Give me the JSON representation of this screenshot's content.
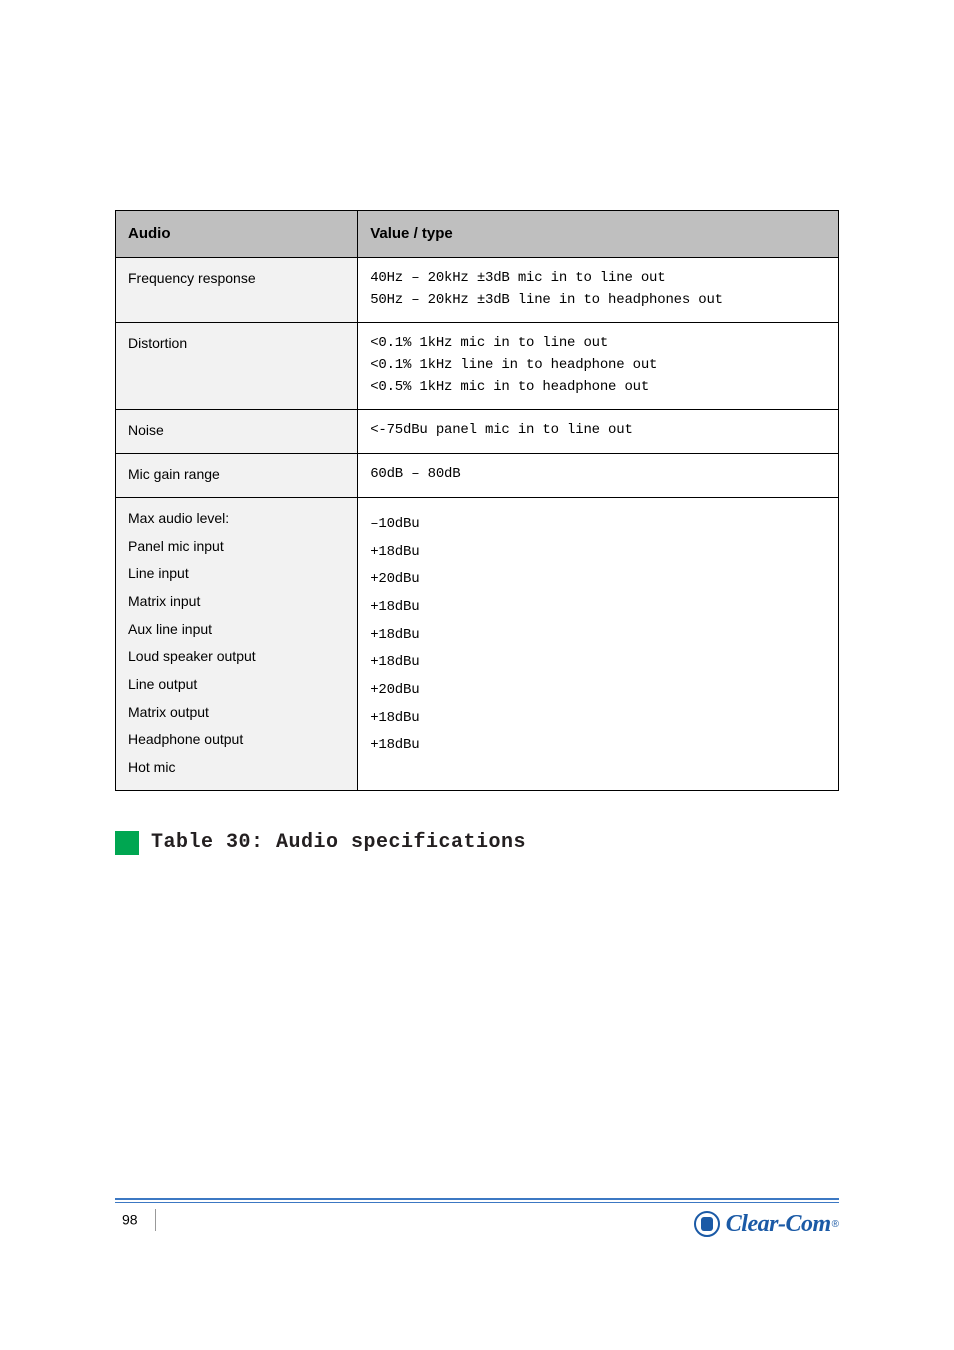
{
  "table": {
    "headers": {
      "left": "Audio",
      "right": "Value / type"
    },
    "rows": [
      {
        "label": "Frequency response",
        "value": {
          "lines": [
            "40Hz – 20kHz ±3dB mic in to line out",
            "50Hz – 20kHz ±3dB line in to headphones out"
          ]
        }
      },
      {
        "label": "Distortion",
        "value": {
          "lines": [
            "<0.1% 1kHz mic in to line out",
            "<0.1% 1kHz line in to headphone out",
            "<0.5% 1kHz mic in to headphone out"
          ]
        }
      },
      {
        "label": "Noise",
        "value": {
          "lines": [
            "<-75dBu panel mic in to line out"
          ]
        }
      },
      {
        "label": "Mic gain range",
        "value": {
          "lines": [
            "60dB – 80dB"
          ]
        }
      },
      {
        "label": "Max audio level:",
        "value": {
          "lines": [
            ""
          ]
        },
        "sub": [
          {
            "l": "Panel mic input",
            "r": "–10dBu"
          },
          {
            "l": "Line input",
            "r": "+18dBu"
          },
          {
            "l": "Matrix input",
            "r": "+20dBu"
          },
          {
            "l": "Aux line input",
            "r": "+18dBu"
          },
          {
            "l": "Loud speaker output",
            "r": "+18dBu"
          },
          {
            "l": "Line output",
            "r": "+18dBu"
          },
          {
            "l": "Matrix output",
            "r": "+20dBu"
          },
          {
            "l": "Headphone output",
            "r": "+18dBu"
          },
          {
            "l": "Hot mic",
            "r": "+18dBu"
          }
        ]
      }
    ]
  },
  "section": {
    "title": "Table 30: Audio specifications"
  },
  "footer": {
    "page": "98",
    "brand": "Clear-Com",
    "reg": "®"
  }
}
